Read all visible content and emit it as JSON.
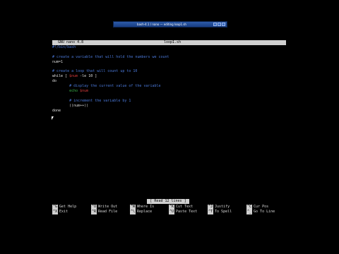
{
  "window": {
    "title": "bash-4.1 / nano — editing loop1.sh"
  },
  "nano": {
    "version": "GNU nano 4.8",
    "filename": "loop1.sh",
    "status": "[ Read 12 lines ]"
  },
  "editor_lines": [
    [
      {
        "text": "#!/bin/bash",
        "cls": "c-comment"
      }
    ],
    [
      {
        "text": "",
        "cls": "c-plain"
      }
    ],
    [
      {
        "text": "# create a variable that will hold the numbers we count",
        "cls": "c-comment"
      }
    ],
    [
      {
        "text": "num=1",
        "cls": "c-plain"
      }
    ],
    [
      {
        "text": "",
        "cls": "c-plain"
      }
    ],
    [
      {
        "text": "# create a loop that will count up to 10",
        "cls": "c-comment"
      }
    ],
    [
      {
        "text": "while [ ",
        "cls": "c-kw"
      },
      {
        "text": "$num",
        "cls": "c-red"
      },
      {
        "text": " -le 10 ]",
        "cls": "c-kw"
      }
    ],
    [
      {
        "text": "do",
        "cls": "c-kw"
      }
    ],
    [
      {
        "text": "        # display the current value of the variable",
        "cls": "c-comment"
      }
    ],
    [
      {
        "text": "        echo ",
        "cls": "c-green"
      },
      {
        "text": "$num",
        "cls": "c-red"
      }
    ],
    [
      {
        "text": "",
        "cls": "c-plain"
      }
    ],
    [
      {
        "text": "        # increment the variable by 1",
        "cls": "c-comment"
      }
    ],
    [
      {
        "text": "        ((num++))",
        "cls": "c-plain"
      }
    ],
    [
      {
        "text": "done",
        "cls": "c-kw"
      }
    ]
  ],
  "shortcuts": [
    {
      "key": "^G",
      "label": "Get Help"
    },
    {
      "key": "^O",
      "label": "Write Out"
    },
    {
      "key": "^W",
      "label": "Where Is"
    },
    {
      "key": "^K",
      "label": "Cut Text"
    },
    {
      "key": "^J",
      "label": "Justify"
    },
    {
      "key": "^C",
      "label": "Cur Pos"
    },
    {
      "key": "^X",
      "label": "Exit"
    },
    {
      "key": "^R",
      "label": "Read File"
    },
    {
      "key": "^\\",
      "label": "Replace"
    },
    {
      "key": "^U",
      "label": "Paste Text"
    },
    {
      "key": "^T",
      "label": "To Spell"
    },
    {
      "key": "^_",
      "label": "Go To Line"
    }
  ]
}
